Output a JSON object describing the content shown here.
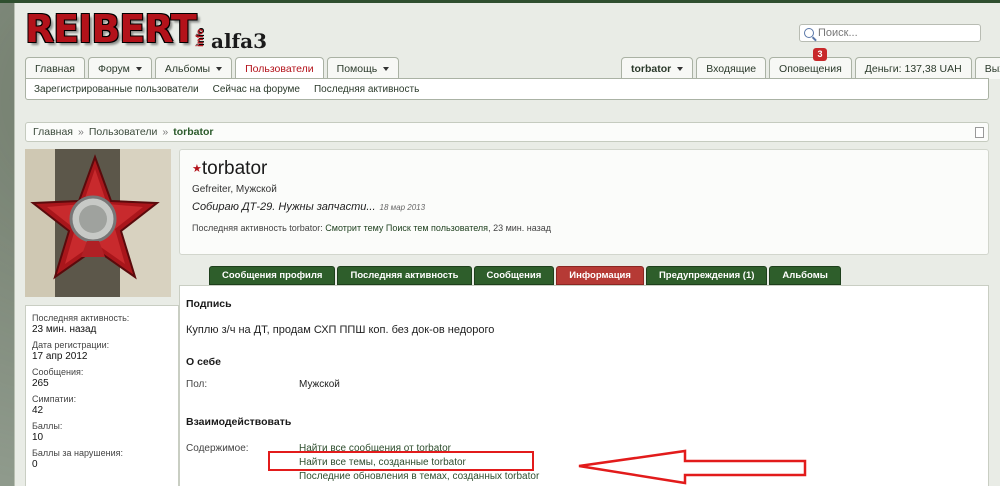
{
  "logo": {
    "main": "REIBERT",
    "info": "info",
    "sub": "alfa3"
  },
  "search": {
    "placeholder": "Поиск..."
  },
  "nav": {
    "tabs": [
      {
        "label": "Главная"
      },
      {
        "label": "Форум"
      },
      {
        "label": "Альбомы"
      },
      {
        "label": "Пользователи"
      },
      {
        "label": "Помощь"
      }
    ],
    "user_menu": {
      "username": "torbator",
      "inbox": "Входящие",
      "alerts": "Оповещения",
      "alerts_count": "3",
      "money": "Деньги: 137,38 UAH",
      "logout": "Выход"
    },
    "subnav": [
      "Зарегистрированные пользователи",
      "Сейчас на форуме",
      "Последняя активность"
    ]
  },
  "breadcrumb": {
    "items": [
      "Главная",
      "Пользователи"
    ],
    "current": "torbator"
  },
  "profile": {
    "username": "torbator",
    "role": "Gefreiter, Мужской",
    "status": "Собираю ДТ-29. Нужны запчасти...",
    "status_date": "18 мар 2013",
    "activity_prefix": "Последняя активность torbator:",
    "activity_link1": "Смотрит тему",
    "activity_link2": "Поиск тем пользователя",
    "activity_time": ", 23 мин. назад"
  },
  "stats": [
    {
      "label": "Последняя активность:",
      "value": "23 мин. назад"
    },
    {
      "label": "Дата регистрации:",
      "value": "17 апр 2012"
    },
    {
      "label": "Сообщения:",
      "value": "265"
    },
    {
      "label": "Симпатии:",
      "value": "42"
    },
    {
      "label": "Баллы:",
      "value": "10"
    },
    {
      "label": "Баллы за нарушения:",
      "value": "0"
    }
  ],
  "profile_tabs": [
    "Сообщения профиля",
    "Последняя активность",
    "Сообщения",
    "Информация",
    "Предупреждения (1)",
    "Альбомы"
  ],
  "info": {
    "signature_title": "Подпись",
    "signature_text": "Куплю з/ч на ДТ, продам СХП ППШ коп. без док-ов недорого",
    "about_title": "О себе",
    "gender_label": "Пол:",
    "gender_value": "Мужской",
    "interact_title": "Взаимодействовать",
    "content_label": "Содержимое:",
    "links": [
      "Найти все сообщения от torbator",
      "Найти все темы, созданные torbator",
      "Последние обновления в темах, созданных torbator"
    ]
  },
  "colors": {
    "accent_red": "#b3121a",
    "tab_green": "#2e5e2b",
    "tab_active": "#b63a35",
    "annotation_red": "#e21b1b"
  }
}
